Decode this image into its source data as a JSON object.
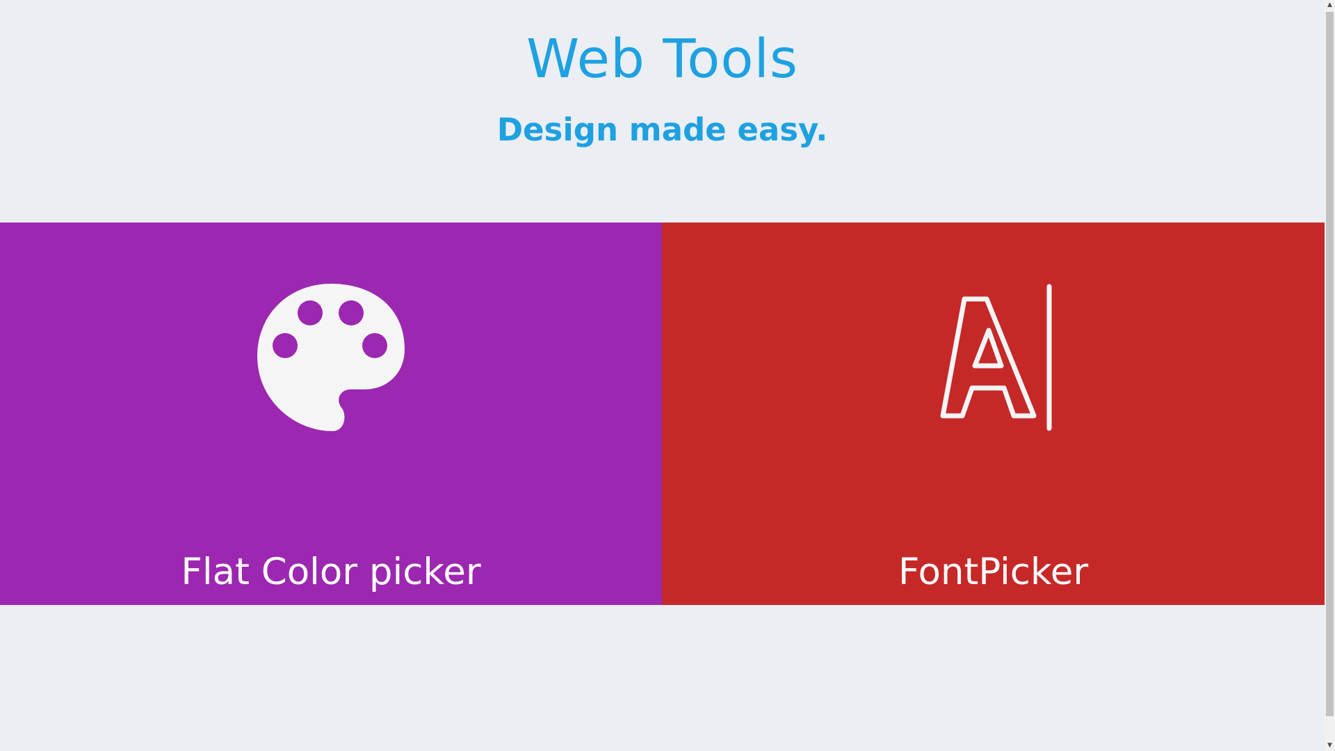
{
  "header": {
    "title": "Web Tools",
    "subtitle": "Design made easy."
  },
  "cards": [
    {
      "label": "Flat Color picker",
      "icon": "palette-icon",
      "color": "#9c27b0"
    },
    {
      "label": "FontPicker",
      "icon": "font-cursor-icon",
      "color": "#c62828"
    }
  ],
  "colors": {
    "background": "#ebeef2",
    "accent": "#1ea1e1",
    "card_text": "#ffffff",
    "icon_fill": "#f5f5f5"
  },
  "scrollbar": {
    "up_glyph": "▲",
    "down_glyph": "▼"
  }
}
